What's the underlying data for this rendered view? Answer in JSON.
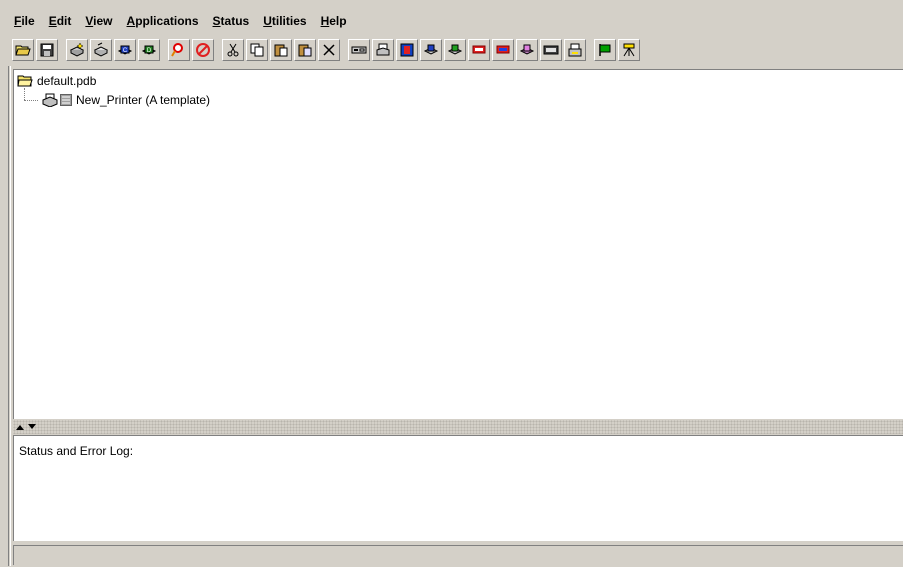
{
  "menubar": {
    "items": [
      "File",
      "Edit",
      "View",
      "Applications",
      "Status",
      "Utilities",
      "Help"
    ]
  },
  "toolbar": {
    "buttons": [
      "open-icon",
      "save-icon",
      "new-printer-icon",
      "new-printer-template-icon",
      "new-class-icon",
      "new-destination-icon",
      "find-icon",
      "stop-icon",
      "cut-icon",
      "copy-icon",
      "paste-icon",
      "paste-special-icon",
      "delete-icon",
      "properties-icon",
      "printer-config-icon",
      "printer-red-icon",
      "printer-queue-icon",
      "printer-check-icon",
      "jobs-red-icon",
      "jobs-blue-icon",
      "printer-purple-icon",
      "panel-icon",
      "printer-drawer-icon",
      "flag-icon",
      "tripod-icon"
    ]
  },
  "tree": {
    "root_label": "default.pdb",
    "child_label": "New_Printer (A template)"
  },
  "log": {
    "label": "Status and Error Log:"
  },
  "colors": {
    "chrome": "#d4d0c8",
    "pane": "#ffffff",
    "folder": "#f5e36b",
    "stop": "#e02020",
    "flag": "#00a000"
  }
}
